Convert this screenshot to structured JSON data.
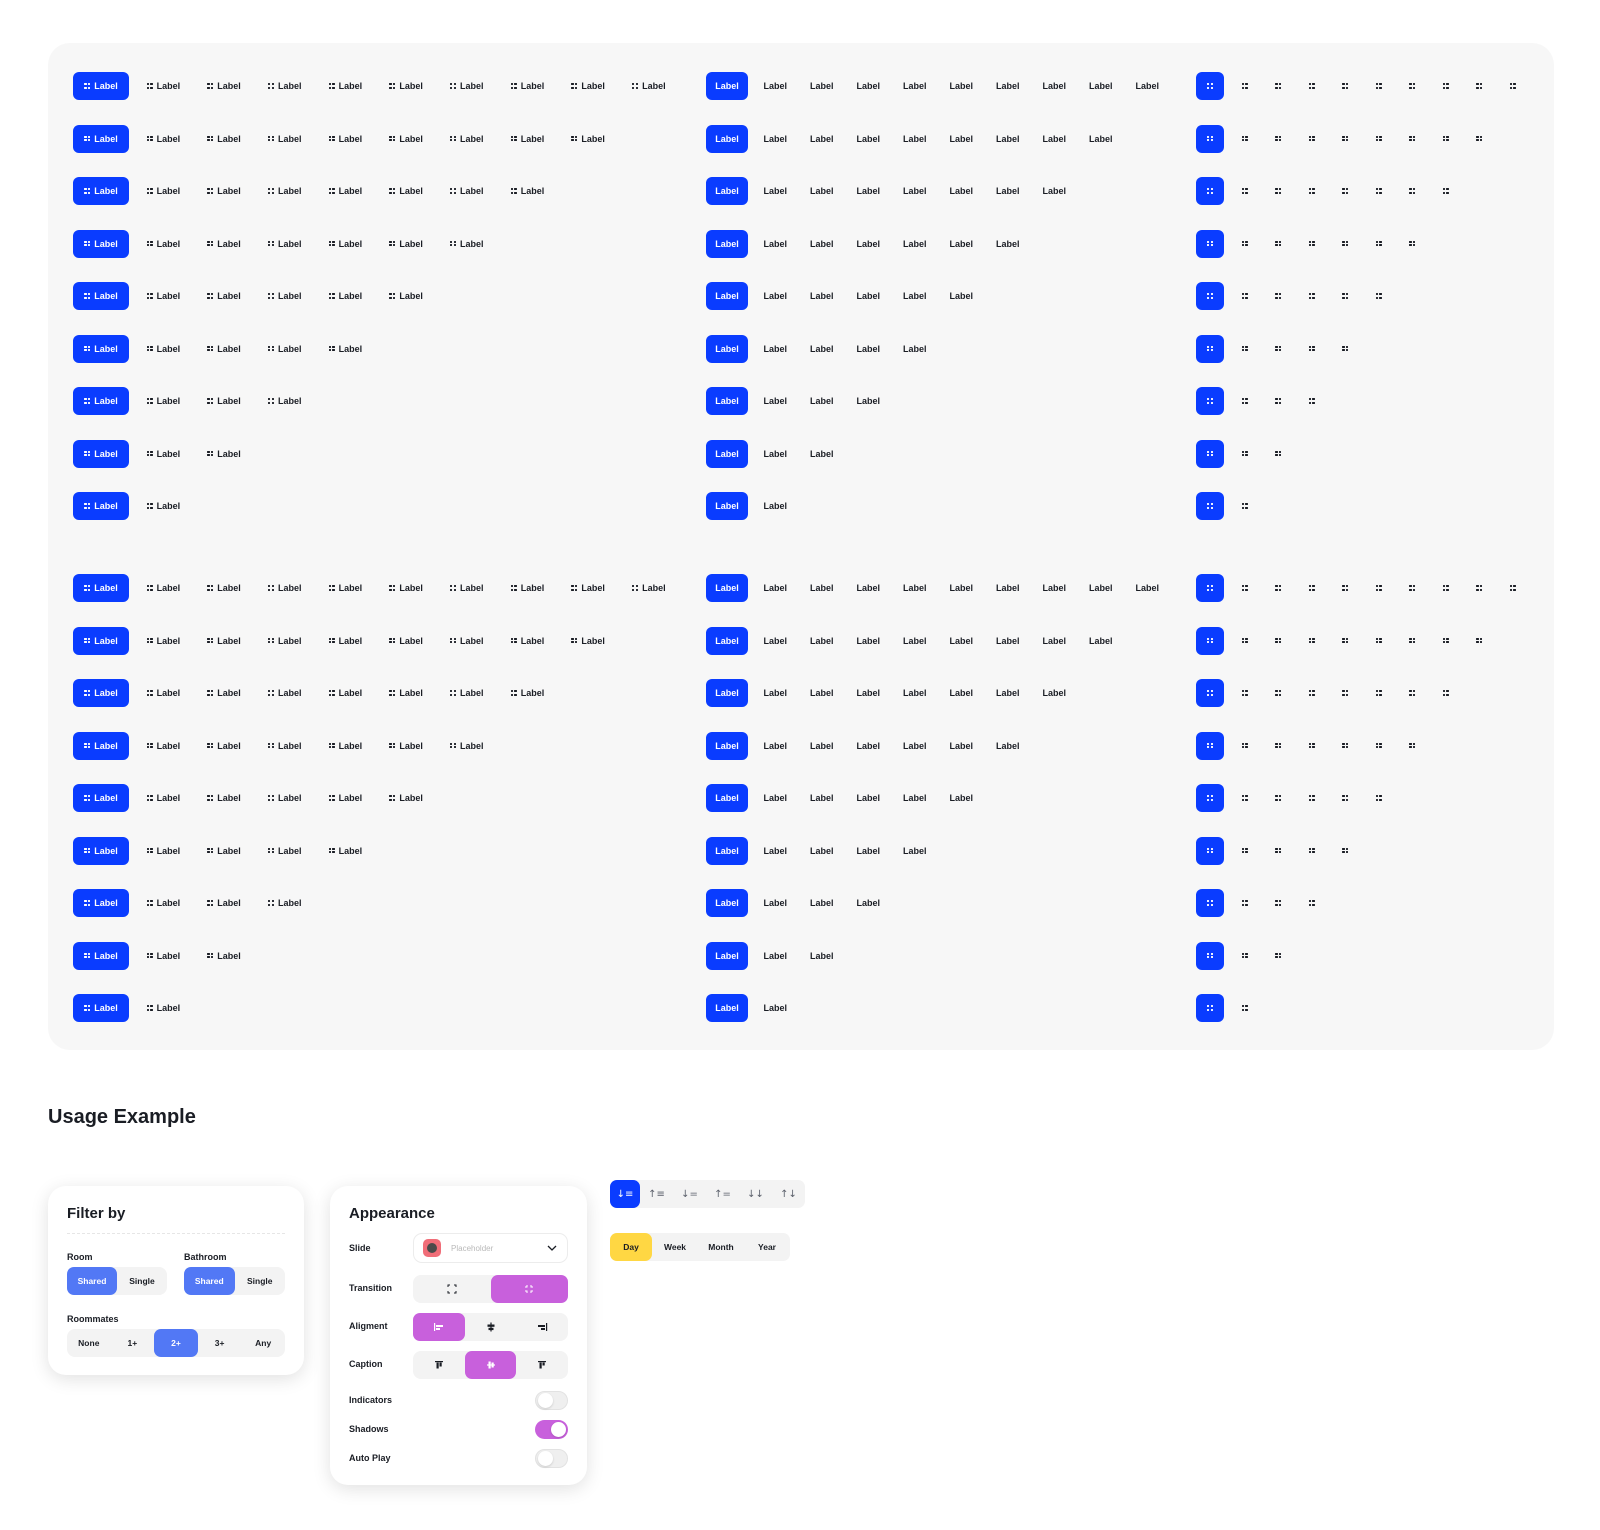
{
  "showcase": {
    "segment_label": "Label",
    "counts": [
      10,
      9,
      8,
      7,
      6,
      5,
      4,
      3,
      2
    ],
    "active_color": "#0a3cff",
    "groups": [
      "icon-and-label",
      "label-only",
      "icon-only"
    ],
    "icon": "grid-dots-icon"
  },
  "usage": {
    "title": "Usage Example",
    "filter": {
      "title": "Filter by",
      "room_label": "Room",
      "room_options": [
        "Shared",
        "Single"
      ],
      "room_selected": "Shared",
      "bathroom_label": "Bathroom",
      "bathroom_options": [
        "Shared",
        "Single"
      ],
      "bathroom_selected": "Shared",
      "roommates_label": "Roommates",
      "roommates_options": [
        "None",
        "1+",
        "2+",
        "3+",
        "Any"
      ],
      "roommates_selected": "2+",
      "accent": "#5278f5"
    },
    "appearance": {
      "title": "Appearance",
      "slide_label": "Slide",
      "slide_placeholder": "Placeholder",
      "transition_label": "Transition",
      "transition_options": [
        "expand-icon",
        "collapse-icon"
      ],
      "transition_selected": 1,
      "alignment_label": "Aligment",
      "alignment_options": [
        "align-left-icon",
        "align-center-icon",
        "align-right-icon"
      ],
      "alignment_selected": 0,
      "caption_label": "Caption",
      "caption_options": [
        "caption-top-icon",
        "caption-middle-icon",
        "caption-bottom-icon"
      ],
      "caption_selected": 1,
      "indicators_label": "Indicators",
      "indicators_on": false,
      "shadows_label": "Shadows",
      "shadows_on": true,
      "autoplay_label": "Auto Play",
      "autoplay_on": false,
      "accent": "#c860dc"
    },
    "sort": {
      "options": [
        "sort-descending-icon",
        "sort-ascending-icon",
        "sort-desc-lines-icon",
        "sort-asc-lines-icon",
        "sort-down-icon",
        "sort-updown-icon"
      ],
      "selected": 0
    },
    "period": {
      "options": [
        "Day",
        "Week",
        "Month",
        "Year"
      ],
      "selected": "Day",
      "accent": "#ffd743"
    }
  }
}
